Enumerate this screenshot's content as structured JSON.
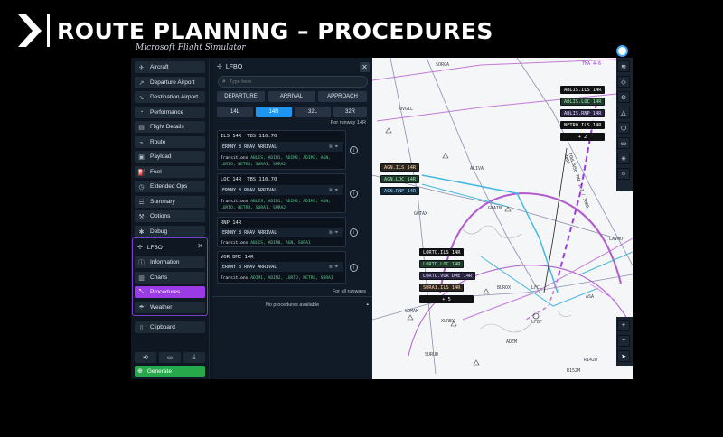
{
  "banner": {
    "title": "ROUTE PLANNING – PROCEDURES"
  },
  "logo": {
    "text": "Microsoft Flight Simulator"
  },
  "nav": {
    "items": [
      {
        "label": "Aircraft",
        "icon": "plane-icon"
      },
      {
        "label": "Departure Airport",
        "icon": "takeoff-icon"
      },
      {
        "label": "Destination Airport",
        "icon": "landing-icon"
      },
      {
        "label": "Performance",
        "icon": "gauge-icon"
      },
      {
        "label": "Flight Details",
        "icon": "document-icon"
      },
      {
        "label": "Route",
        "icon": "route-icon"
      },
      {
        "label": "Payload",
        "icon": "box-icon"
      },
      {
        "label": "Fuel",
        "icon": "fuel-icon"
      },
      {
        "label": "Extended Ops",
        "icon": "clock-icon"
      },
      {
        "label": "Summary",
        "icon": "list-icon"
      },
      {
        "label": "Options",
        "icon": "wrench-icon"
      },
      {
        "label": "Debug",
        "icon": "bug-icon"
      }
    ],
    "airport": {
      "code": "LFBO",
      "items": [
        {
          "label": "Information",
          "icon": "info-icon"
        },
        {
          "label": "Charts",
          "icon": "map-icon"
        },
        {
          "label": "Procedures",
          "icon": "procedures-icon",
          "active": true
        },
        {
          "label": "Weather",
          "icon": "weather-icon"
        }
      ]
    },
    "clipboard": "Clipboard",
    "generate": "Generate"
  },
  "panel": {
    "title": "LFBO",
    "search_placeholder": "Type here",
    "types": [
      "DEPARTURE",
      "ARRIVAL",
      "APPROACH"
    ],
    "runways": [
      "14L",
      "14R",
      "32L",
      "32R"
    ],
    "selected_runway": "14R",
    "for_runway": "For runway 14R",
    "procedures": [
      {
        "name": "ILS 14R",
        "freq": "TBS 110.70",
        "arrival": "ERNNY 8 RNAV ARRIVAL",
        "transitions": [
          "ABLIS,",
          "ADIM1,",
          "ADIM2,",
          "ADIM3,",
          "AGN,",
          "LORTO,",
          "NETRO,",
          "SURA1,",
          "SURA2"
        ]
      },
      {
        "name": "LOC 14R",
        "freq": "TBS 110.70",
        "arrival": "ERNNY 8 RNAV ARRIVAL",
        "transitions": [
          "ABLIS,",
          "ADIM1,",
          "ADIM2,",
          "ADIM3,",
          "AGN,",
          "LORTO,",
          "NETRO,",
          "SURA1,",
          "SURA2"
        ]
      },
      {
        "name": "RNP 14R",
        "freq": "",
        "arrival": "ERNNY 8 RNAV ARRIVAL",
        "transitions": [
          "ABLIS,",
          "ADIM0,",
          "AGN,",
          "SURA1"
        ]
      },
      {
        "name": "VOR DME 14R",
        "freq": "",
        "arrival": "ERNNY 8 RNAV ARRIVAL",
        "transitions": [
          "ADIM1,",
          "ADIM2,",
          "LORTO,",
          "NETRO,",
          "SURA1"
        ]
      }
    ],
    "transitions_label": "Transitions",
    "for_all_runways": "For all runways",
    "no_procedures": "No procedures available"
  },
  "map": {
    "labels": {
      "sorga": "SORGA",
      "tma": "TMA 4-6",
      "ovgil": "OVGIL",
      "aliva": "ALIVA",
      "gotax": "GOTAX",
      "gwain": "GWAIN",
      "lavmo": "LAVMO",
      "toulouse": "TOULOUSE TMA 1.2 / 3000-4000",
      "burox": "BUROX",
      "lfcl": "LFCL",
      "lfbf": "LFBF",
      "asa": "ASA",
      "gomam": "GOMAM",
      "xurex": "XUREX",
      "surud": "SURUD",
      "adem": "ADEM",
      "r142m": "R142M",
      "r152m": "R152M"
    },
    "tags_top": [
      {
        "text": "ABLIS.ILS 14R",
        "style": "dark"
      },
      {
        "text": "ABLIS.LOC 14R",
        "style": "g"
      },
      {
        "text": "ABLIS.RNP 14R",
        "style": "p"
      },
      {
        "text": "NETRO.ILS 14R",
        "style": "dark"
      },
      {
        "text": "+ 2",
        "style": "dark"
      }
    ],
    "tags_mid": [
      {
        "text": "AGN.ILS 14R",
        "style": "o"
      },
      {
        "text": "AGN.LOC 14R",
        "style": "g"
      },
      {
        "text": "AGN.RNP 14R",
        "style": "b"
      }
    ],
    "tags_bottom": [
      {
        "text": "LORTO.ILS 14R",
        "style": "dark"
      },
      {
        "text": "LORTO.LOC 14R",
        "style": "g"
      },
      {
        "text": "LORTO.VOR DME 14R",
        "style": "p"
      },
      {
        "text": "SURA1.ILS 14R",
        "style": "o"
      },
      {
        "text": "+ 5",
        "style": "dark"
      }
    ]
  }
}
